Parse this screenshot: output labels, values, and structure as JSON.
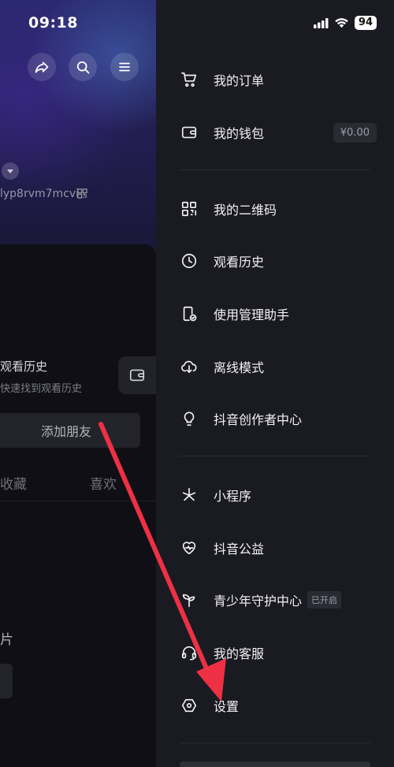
{
  "status_bar": {
    "time": "09:18",
    "battery": "94"
  },
  "profile_background": {
    "user_id": "lyp8rvm7mcvi",
    "history_title": "观看历史",
    "history_subtitle": "快速找到观看历史",
    "add_friend": "添加朋友",
    "tabs": [
      "收藏",
      "喜欢"
    ],
    "photo_label": "片"
  },
  "drawer": {
    "items": [
      {
        "label": "我的订单",
        "icon": "cart-icon"
      },
      {
        "label": "我的钱包",
        "icon": "wallet-icon",
        "value": "¥0.00"
      },
      {
        "label": "我的二维码",
        "icon": "qr-code-icon"
      },
      {
        "label": "观看历史",
        "icon": "clock-icon"
      },
      {
        "label": "使用管理助手",
        "icon": "phone-check-icon"
      },
      {
        "label": "离线模式",
        "icon": "cloud-download-icon"
      },
      {
        "label": "抖音创作者中心",
        "icon": "lightbulb-icon"
      },
      {
        "label": "小程序",
        "icon": "asterisk-icon"
      },
      {
        "label": "抖音公益",
        "icon": "heart-pulse-icon"
      },
      {
        "label": "青少年守护中心",
        "icon": "sprout-icon",
        "tag": "已开启"
      },
      {
        "label": "我的客服",
        "icon": "headset-icon"
      },
      {
        "label": "设置",
        "icon": "hexagon-settings-icon"
      }
    ]
  },
  "colors": {
    "annotation_arrow": "#ee3044",
    "drawer_bg": "#1a1a22"
  }
}
